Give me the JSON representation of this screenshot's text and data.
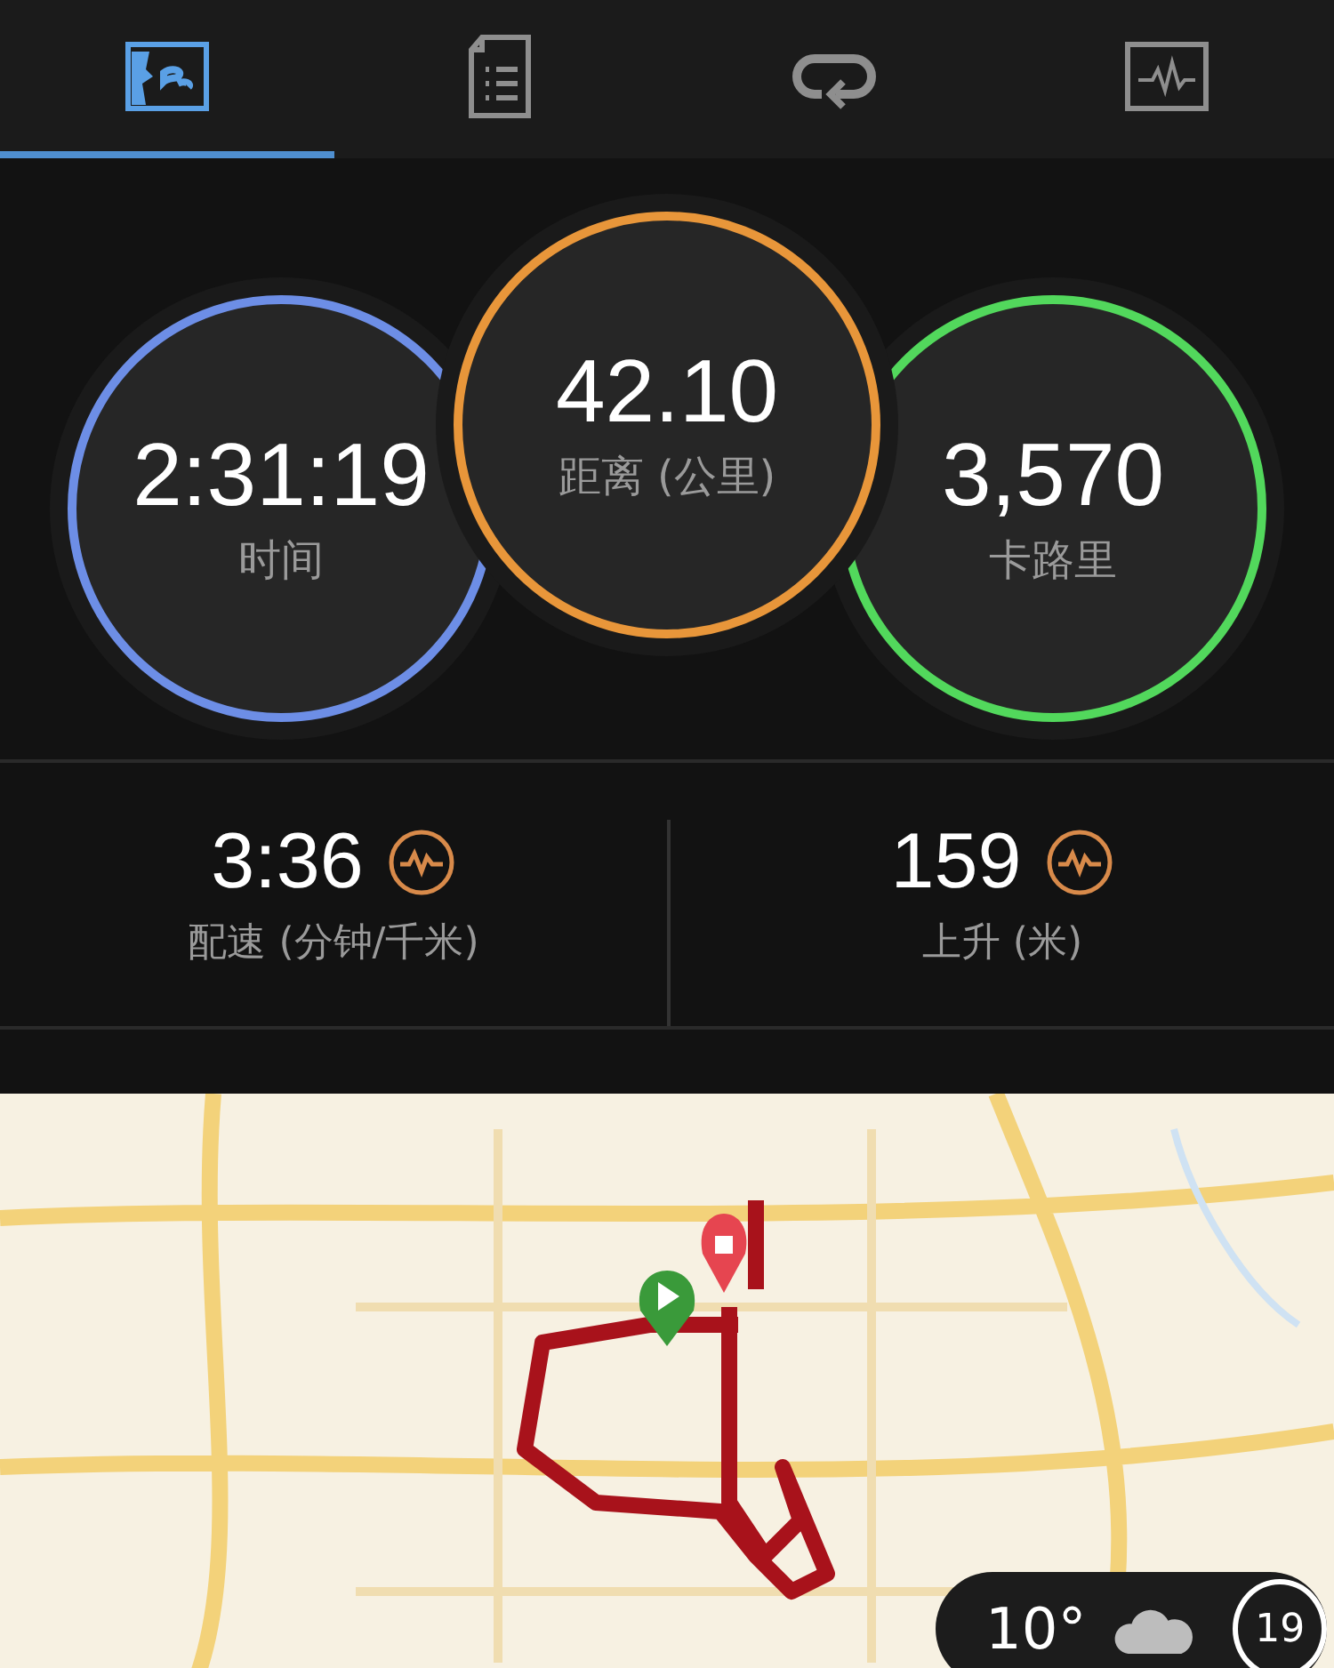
{
  "tabs": [
    {
      "kind": "map",
      "selected": true
    },
    {
      "kind": "list",
      "selected": false
    },
    {
      "kind": "laps",
      "selected": false
    },
    {
      "kind": "chart",
      "selected": false
    }
  ],
  "circles": [
    {
      "value": "2:31:19",
      "label": "时间",
      "color": "#6d8ee6",
      "raised": false
    },
    {
      "value": "42.10",
      "label": "距离 (公里)",
      "color": "#e8963a",
      "raised": true
    },
    {
      "value": "3,570",
      "label": "卡路里",
      "color": "#52d85c",
      "raised": false
    }
  ],
  "metrics": [
    {
      "value": "3:36",
      "label": "配速 (分钟/千米)"
    },
    {
      "value": "159",
      "label": "上升 (米)"
    }
  ],
  "weather": {
    "temperature": "10°",
    "dial": "19"
  }
}
